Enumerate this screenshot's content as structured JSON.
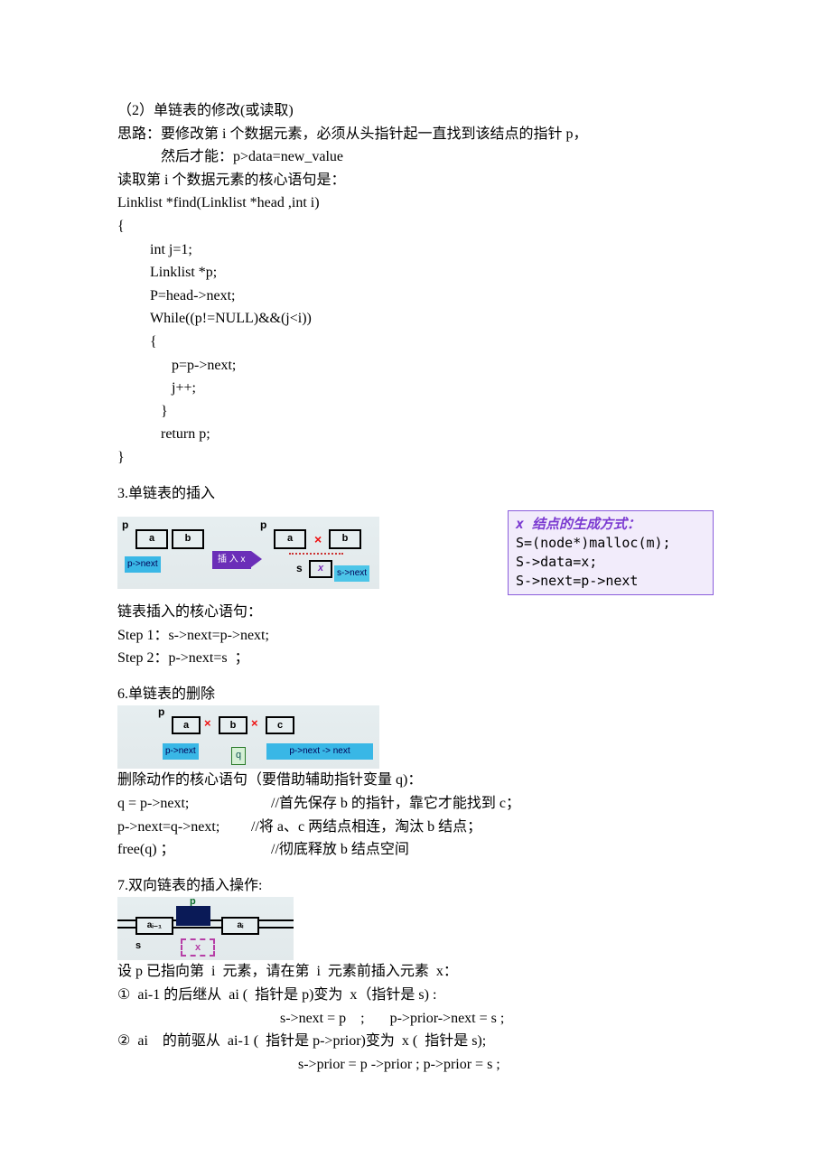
{
  "s1": {
    "title": "（2）单链表的修改(或读取)",
    "idea_label": "思路：",
    "idea_text": "要修改第 i 个数据元素，必须从头指针起一直找到该结点的指针 p，",
    "idea_text2": "然后才能：p>data=new_value",
    "read_intro": "读取第 i 个数据元素的核心语句是：",
    "code1": "Linklist *find(Linklist *head ,int i)",
    "code2": "{",
    "code3": "int j=1;",
    "code4": "Linklist *p;",
    "code5": "P=head->next;",
    "code6": "While((p!=NULL)&&(j<i))",
    "code7": "{",
    "code8": "p=p->next;",
    "code9": "j++;",
    "code10": "}",
    "code11": "return p;",
    "code12": "}"
  },
  "s3": {
    "title": "3.单链表的插入",
    "d": {
      "p": "p",
      "a": "a",
      "b": "b",
      "insert": "插 入 x",
      "s": "s",
      "x": "x",
      "pnext": "p->next",
      "snext": "s->next"
    },
    "side_title": "x 结点的生成方式：",
    "side_l1": "S=(node*)malloc(m);",
    "side_l2": "S->data=x;",
    "side_l3": "S->next=p->next",
    "core_label": "链表插入的核心语句：",
    "step1": "Step 1：s->next=p->next;",
    "step2": "Step 2：p->next=s  ；"
  },
  "s6": {
    "title": "6.单链表的删除",
    "d": {
      "p": "p",
      "a": "a",
      "b": "b",
      "c": "c",
      "pnext": "p->next",
      "pnn": "p->next -> next",
      "q": "q"
    },
    "core_label": "删除动作的核心语句（要借助辅助指针变量 q)：",
    "l1a": "q = p->next;",
    "l1b": "//首先保存 b 的指针，靠它才能找到 c；",
    "l2a": "p->next=q->next;",
    "l2b": "//将 a、c 两结点相连，淘汰 b 结点；",
    "l3a": "free(q) ；",
    "l3b": "//彻底释放 b 结点空间"
  },
  "s7": {
    "title": "7.双向链表的插入操作:",
    "d": {
      "p": "p",
      "ai1": "aᵢ₋₁",
      "ai": "aᵢ",
      "s": "s",
      "x": "x"
    },
    "assume": "设 p 已指向第  i  元素，请在第  i  元素前插入元素  x：",
    "step1": "①  ai-1 的后继从  ai (  指针是 p)变为  x（指针是 s) :",
    "code1": "s->next = p    ;       p->prior->next = s ;",
    "step2": "②  ai    的前驱从  ai-1 (  指针是 p->prior)变为  x (  指针是 s);",
    "code2": "s->prior = p ->prior ; p->prior = s ;"
  }
}
